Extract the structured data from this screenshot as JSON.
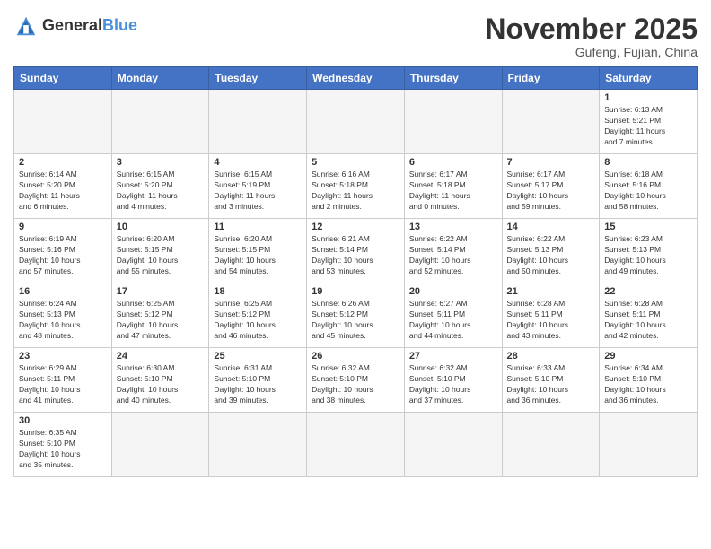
{
  "header": {
    "logo_general": "General",
    "logo_blue": "Blue",
    "month_title": "November 2025",
    "location": "Gufeng, Fujian, China"
  },
  "weekdays": [
    "Sunday",
    "Monday",
    "Tuesday",
    "Wednesday",
    "Thursday",
    "Friday",
    "Saturday"
  ],
  "weeks": [
    [
      {
        "day": "",
        "info": ""
      },
      {
        "day": "",
        "info": ""
      },
      {
        "day": "",
        "info": ""
      },
      {
        "day": "",
        "info": ""
      },
      {
        "day": "",
        "info": ""
      },
      {
        "day": "",
        "info": ""
      },
      {
        "day": "1",
        "info": "Sunrise: 6:13 AM\nSunset: 5:21 PM\nDaylight: 11 hours\nand 7 minutes."
      }
    ],
    [
      {
        "day": "2",
        "info": "Sunrise: 6:14 AM\nSunset: 5:20 PM\nDaylight: 11 hours\nand 6 minutes."
      },
      {
        "day": "3",
        "info": "Sunrise: 6:15 AM\nSunset: 5:20 PM\nDaylight: 11 hours\nand 4 minutes."
      },
      {
        "day": "4",
        "info": "Sunrise: 6:15 AM\nSunset: 5:19 PM\nDaylight: 11 hours\nand 3 minutes."
      },
      {
        "day": "5",
        "info": "Sunrise: 6:16 AM\nSunset: 5:18 PM\nDaylight: 11 hours\nand 2 minutes."
      },
      {
        "day": "6",
        "info": "Sunrise: 6:17 AM\nSunset: 5:18 PM\nDaylight: 11 hours\nand 0 minutes."
      },
      {
        "day": "7",
        "info": "Sunrise: 6:17 AM\nSunset: 5:17 PM\nDaylight: 10 hours\nand 59 minutes."
      },
      {
        "day": "8",
        "info": "Sunrise: 6:18 AM\nSunset: 5:16 PM\nDaylight: 10 hours\nand 58 minutes."
      }
    ],
    [
      {
        "day": "9",
        "info": "Sunrise: 6:19 AM\nSunset: 5:16 PM\nDaylight: 10 hours\nand 57 minutes."
      },
      {
        "day": "10",
        "info": "Sunrise: 6:20 AM\nSunset: 5:15 PM\nDaylight: 10 hours\nand 55 minutes."
      },
      {
        "day": "11",
        "info": "Sunrise: 6:20 AM\nSunset: 5:15 PM\nDaylight: 10 hours\nand 54 minutes."
      },
      {
        "day": "12",
        "info": "Sunrise: 6:21 AM\nSunset: 5:14 PM\nDaylight: 10 hours\nand 53 minutes."
      },
      {
        "day": "13",
        "info": "Sunrise: 6:22 AM\nSunset: 5:14 PM\nDaylight: 10 hours\nand 52 minutes."
      },
      {
        "day": "14",
        "info": "Sunrise: 6:22 AM\nSunset: 5:13 PM\nDaylight: 10 hours\nand 50 minutes."
      },
      {
        "day": "15",
        "info": "Sunrise: 6:23 AM\nSunset: 5:13 PM\nDaylight: 10 hours\nand 49 minutes."
      }
    ],
    [
      {
        "day": "16",
        "info": "Sunrise: 6:24 AM\nSunset: 5:13 PM\nDaylight: 10 hours\nand 48 minutes."
      },
      {
        "day": "17",
        "info": "Sunrise: 6:25 AM\nSunset: 5:12 PM\nDaylight: 10 hours\nand 47 minutes."
      },
      {
        "day": "18",
        "info": "Sunrise: 6:25 AM\nSunset: 5:12 PM\nDaylight: 10 hours\nand 46 minutes."
      },
      {
        "day": "19",
        "info": "Sunrise: 6:26 AM\nSunset: 5:12 PM\nDaylight: 10 hours\nand 45 minutes."
      },
      {
        "day": "20",
        "info": "Sunrise: 6:27 AM\nSunset: 5:11 PM\nDaylight: 10 hours\nand 44 minutes."
      },
      {
        "day": "21",
        "info": "Sunrise: 6:28 AM\nSunset: 5:11 PM\nDaylight: 10 hours\nand 43 minutes."
      },
      {
        "day": "22",
        "info": "Sunrise: 6:28 AM\nSunset: 5:11 PM\nDaylight: 10 hours\nand 42 minutes."
      }
    ],
    [
      {
        "day": "23",
        "info": "Sunrise: 6:29 AM\nSunset: 5:11 PM\nDaylight: 10 hours\nand 41 minutes."
      },
      {
        "day": "24",
        "info": "Sunrise: 6:30 AM\nSunset: 5:10 PM\nDaylight: 10 hours\nand 40 minutes."
      },
      {
        "day": "25",
        "info": "Sunrise: 6:31 AM\nSunset: 5:10 PM\nDaylight: 10 hours\nand 39 minutes."
      },
      {
        "day": "26",
        "info": "Sunrise: 6:32 AM\nSunset: 5:10 PM\nDaylight: 10 hours\nand 38 minutes."
      },
      {
        "day": "27",
        "info": "Sunrise: 6:32 AM\nSunset: 5:10 PM\nDaylight: 10 hours\nand 37 minutes."
      },
      {
        "day": "28",
        "info": "Sunrise: 6:33 AM\nSunset: 5:10 PM\nDaylight: 10 hours\nand 36 minutes."
      },
      {
        "day": "29",
        "info": "Sunrise: 6:34 AM\nSunset: 5:10 PM\nDaylight: 10 hours\nand 36 minutes."
      }
    ],
    [
      {
        "day": "30",
        "info": "Sunrise: 6:35 AM\nSunset: 5:10 PM\nDaylight: 10 hours\nand 35 minutes."
      },
      {
        "day": "",
        "info": ""
      },
      {
        "day": "",
        "info": ""
      },
      {
        "day": "",
        "info": ""
      },
      {
        "day": "",
        "info": ""
      },
      {
        "day": "",
        "info": ""
      },
      {
        "day": "",
        "info": ""
      }
    ]
  ]
}
